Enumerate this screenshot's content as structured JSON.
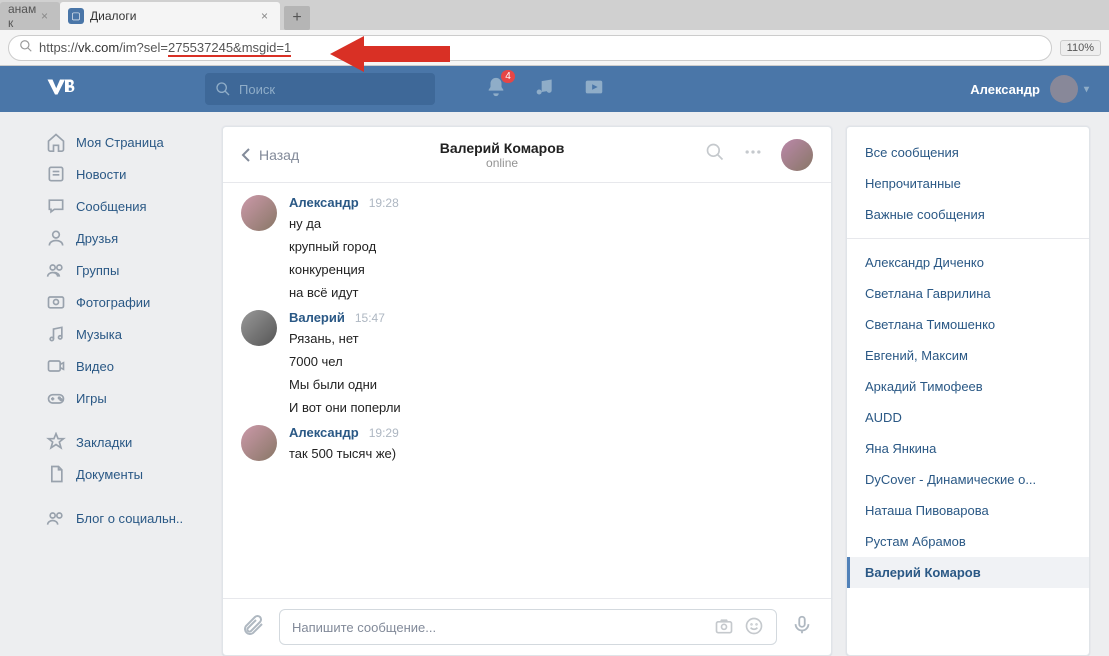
{
  "browser": {
    "tab_inactive": "анам к",
    "tab_active": "Диалоги",
    "url_prefix": "https://",
    "url_host": "vk.com",
    "url_path1": "/im?sel=",
    "url_path2": "275537245&msgid=1",
    "zoom": "110%"
  },
  "header": {
    "search_placeholder": "Поиск",
    "notif_count": "4",
    "user": "Александр"
  },
  "nav": [
    {
      "icon": "home",
      "label": "Моя Страница"
    },
    {
      "icon": "news",
      "label": "Новости"
    },
    {
      "icon": "msg",
      "label": "Сообщения"
    },
    {
      "icon": "friends",
      "label": "Друзья"
    },
    {
      "icon": "groups",
      "label": "Группы"
    },
    {
      "icon": "photo",
      "label": "Фотографии"
    },
    {
      "icon": "music",
      "label": "Музыка"
    },
    {
      "icon": "video",
      "label": "Видео"
    },
    {
      "icon": "games",
      "label": "Игры"
    }
  ],
  "nav2": [
    {
      "icon": "bookmark",
      "label": "Закладки"
    },
    {
      "icon": "doc",
      "label": "Документы"
    }
  ],
  "nav3": [
    {
      "icon": "blog",
      "label": "Блог о социальн.."
    }
  ],
  "chat": {
    "back": "Назад",
    "title": "Валерий Комаров",
    "status": "online",
    "messages": [
      {
        "author": "Александр",
        "time": "19:28",
        "avatar": "a1",
        "lines": [
          "ну да",
          "крупный город",
          "конкуренция",
          "на всё идут"
        ]
      },
      {
        "author": "Валерий",
        "time": "15:47",
        "avatar": "a2",
        "lines": [
          "Рязань, нет",
          "7000 чел",
          "Мы были одни",
          "И вот они поперли"
        ]
      },
      {
        "author": "Александр",
        "time": "19:29",
        "avatar": "a1",
        "lines": [
          "так 500 тысяч же)"
        ]
      }
    ],
    "input_placeholder": "Напишите сообщение..."
  },
  "filters": [
    "Все сообщения",
    "Непрочитанные",
    "Важные сообщения"
  ],
  "contacts": [
    "Александр Диченко",
    "Светлана Гаврилина",
    "Светлана Тимошенко",
    "Евгений, Максим",
    "Аркадий Тимофеев",
    "AUDD",
    "Яна Янкина",
    "DyCover - Динамические о...",
    "Наташа Пивоварова",
    "Рустам Абрамов",
    "Валерий Комаров"
  ],
  "active_contact": "Валерий Комаров"
}
